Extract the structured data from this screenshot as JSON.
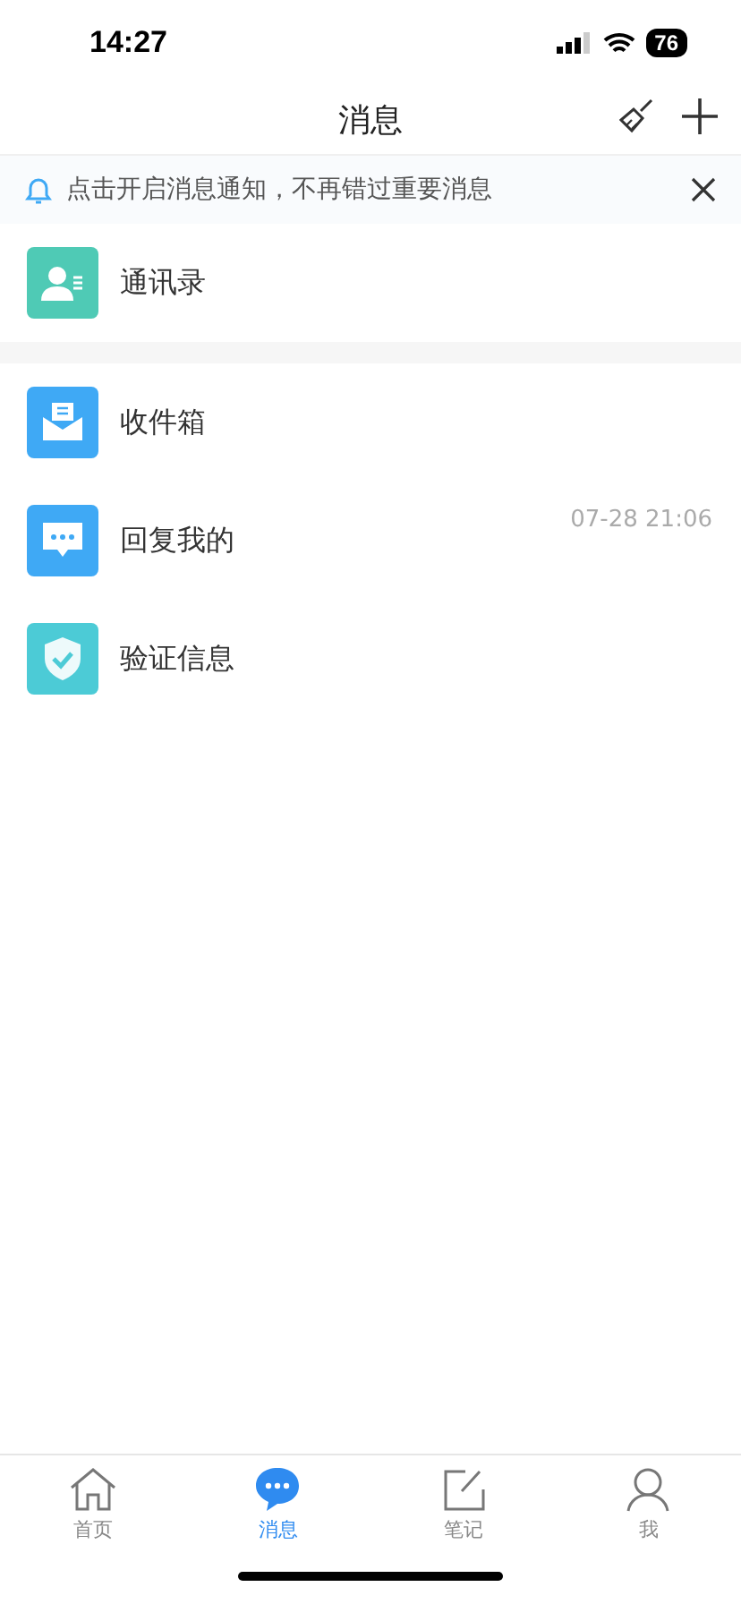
{
  "status_bar": {
    "time": "14:27",
    "battery": "76"
  },
  "nav": {
    "title": "消息"
  },
  "banner": {
    "text": "点击开启消息通知，不再错过重要消息"
  },
  "top_items": [
    {
      "kind": "contacts",
      "label": "通讯录"
    }
  ],
  "items": [
    {
      "kind": "inbox",
      "label": "收件箱"
    },
    {
      "kind": "reply",
      "label": "回复我的",
      "time": "07-28 21:06"
    },
    {
      "kind": "verify",
      "label": "验证信息"
    }
  ],
  "tabs": [
    {
      "kind": "home",
      "label": "首页",
      "selected": false
    },
    {
      "kind": "messages",
      "label": "消息",
      "selected": true
    },
    {
      "kind": "notes",
      "label": "笔记",
      "selected": false
    },
    {
      "kind": "me",
      "label": "我",
      "selected": false
    }
  ]
}
